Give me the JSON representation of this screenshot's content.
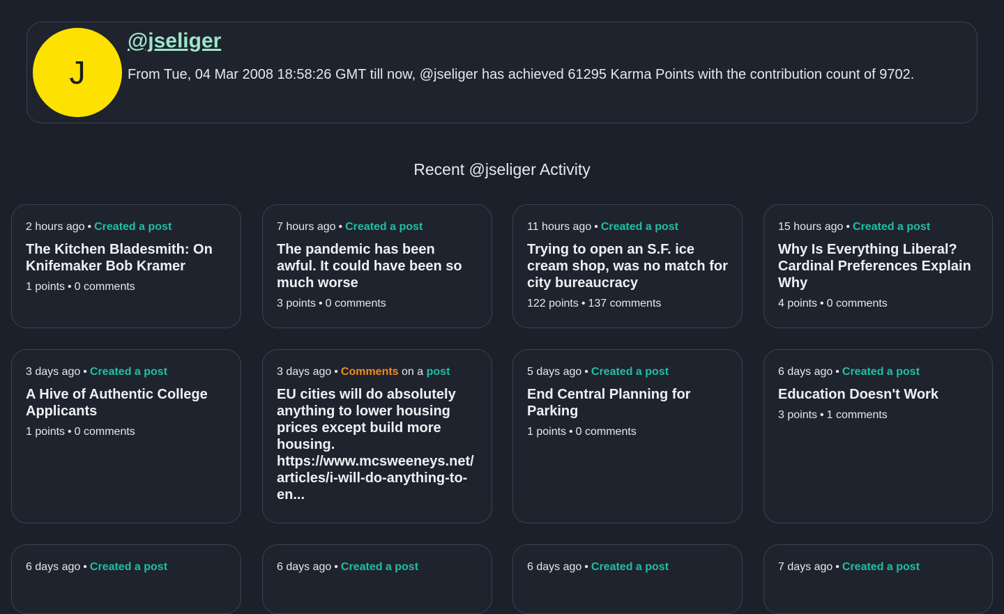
{
  "profile": {
    "avatar_letter": "J",
    "handle": "@jseliger",
    "summary": "From Tue, 04 Mar 2008 18:58:26 GMT till now, @jseliger has achieved 61295 Karma Points with the contribution count of 9702."
  },
  "section_title": "Recent @jseliger Activity",
  "cards": [
    {
      "time": "2 hours ago",
      "action": "Created a post",
      "title": "The Kitchen Bladesmith: On Knifemaker Bob Kramer",
      "points": "1 points",
      "comments": "0 comments"
    },
    {
      "time": "7 hours ago",
      "action": "Created a post",
      "title": "The pandemic has been awful. It could have been so much worse",
      "points": "3 points",
      "comments": "0 comments"
    },
    {
      "time": "11 hours ago",
      "action": "Created a post",
      "title": "Trying to open an S.F. ice cream shop, was no match for city bureaucracy",
      "points": "122 points",
      "comments": "137 comments"
    },
    {
      "time": "15 hours ago",
      "action": "Created a post",
      "title": "Why Is Everything Liberal? Cardinal Preferences Explain Why",
      "points": "4 points",
      "comments": "0 comments"
    },
    {
      "time": "3 days ago",
      "action": "Created a post",
      "title": "A Hive of Authentic College Applicants",
      "points": "1 points",
      "comments": "0 comments"
    },
    {
      "time": "3 days ago",
      "action_comment": "Comments",
      "action_on": "on a",
      "action_post": "post",
      "title": "EU cities will do absolutely anything to lower housing prices except build more housing. https://www.mcsweeneys.net/articles/i-will-do-anything-to-en..."
    },
    {
      "time": "5 days ago",
      "action": "Created a post",
      "title": "End Central Planning for Parking",
      "points": "1 points",
      "comments": "0 comments"
    },
    {
      "time": "6 days ago",
      "action": "Created a post",
      "title": "Education Doesn't Work",
      "points": "3 points",
      "comments": "1 comments"
    },
    {
      "time": "6 days ago",
      "action": "Created a post"
    },
    {
      "time": "6 days ago",
      "action": "Created a post"
    },
    {
      "time": "6 days ago",
      "action": "Created a post"
    },
    {
      "time": "7 days ago",
      "action": "Created a post"
    }
  ],
  "colors": {
    "background": "#1b202b",
    "card": "#1e232d",
    "handle": "#9ee6c9",
    "created": "#1fbfa6",
    "comment": "#ef8a22",
    "avatar": "#fde100"
  }
}
